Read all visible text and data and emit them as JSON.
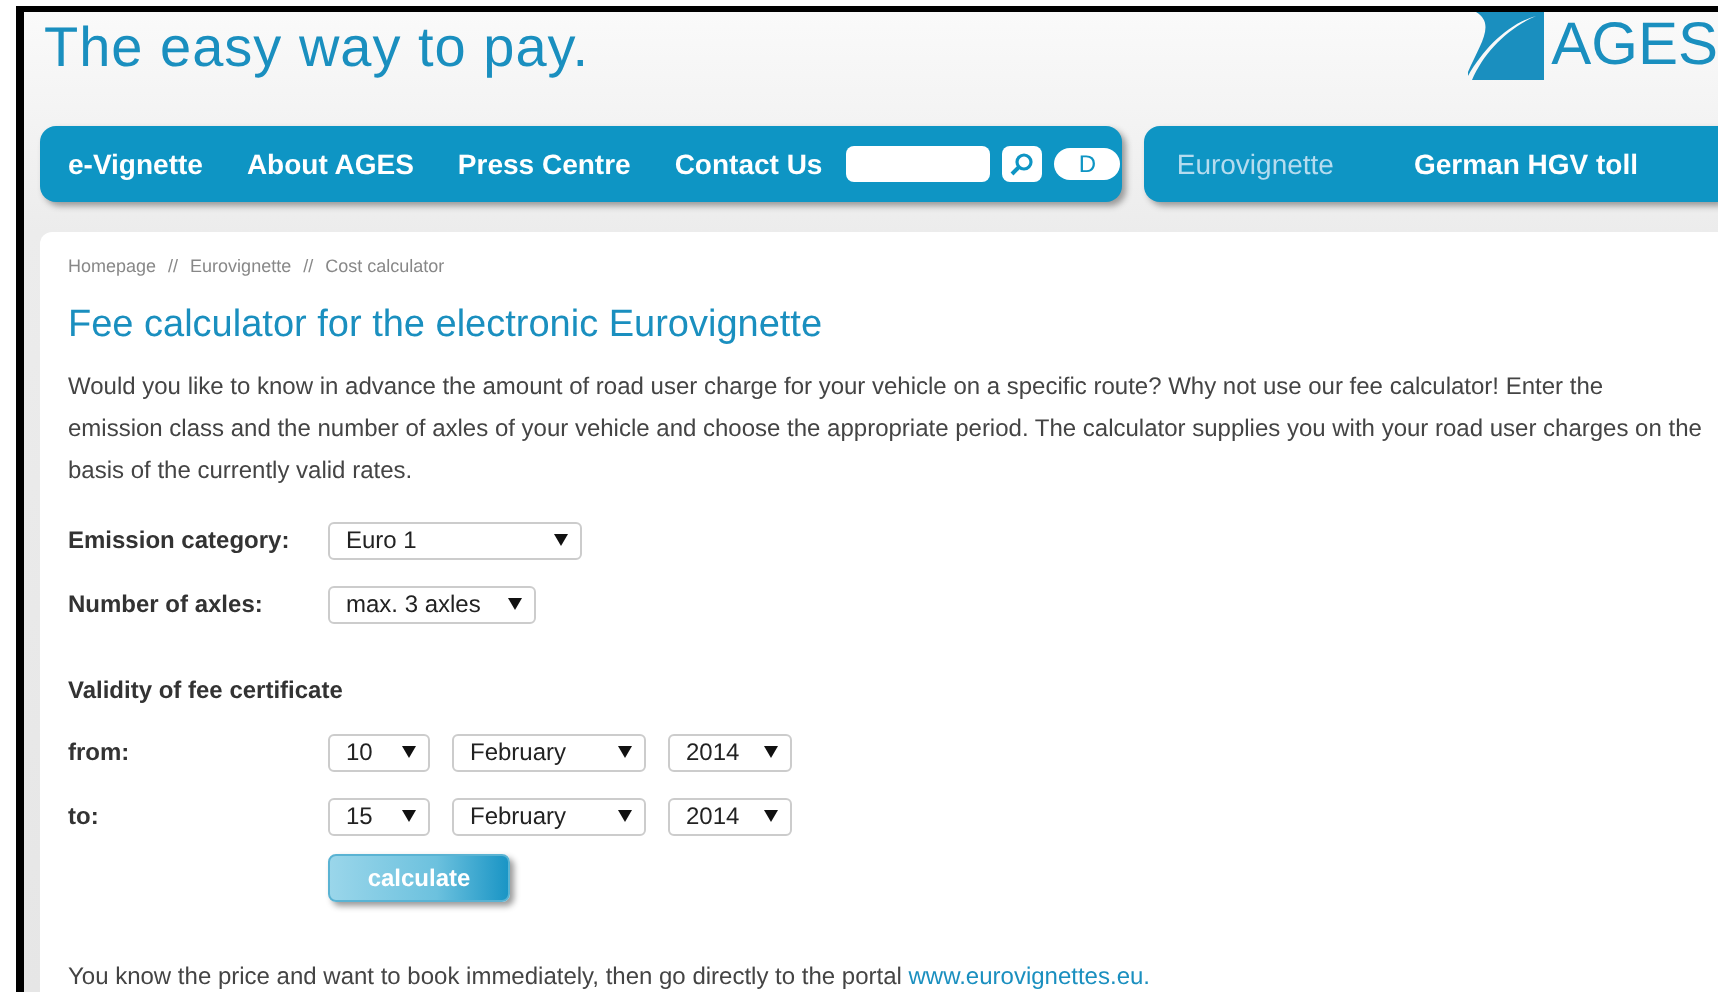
{
  "header": {
    "slogan": "The easy way to pay.",
    "logo_text": "AGES"
  },
  "nav_main": [
    {
      "label": "e-Vignette",
      "selected": false
    },
    {
      "label": "About AGES",
      "selected": false
    },
    {
      "label": "Press Centre",
      "selected": false
    },
    {
      "label": "Contact Us",
      "selected": false
    }
  ],
  "search": {
    "language_button": "D"
  },
  "nav_sections": [
    {
      "label": "Eurovignette",
      "selected": true
    },
    {
      "label": "German HGV toll",
      "selected": false
    }
  ],
  "breadcrumb": [
    "Homepage",
    "Eurovignette",
    "Cost calculator"
  ],
  "breadcrumb_separator": "//",
  "heading": "Fee calculator for the electronic Eurovignette",
  "intro": "Would you like to know in advance the amount of road user charge for your vehicle on a specific route? Why not use our fee calculator! Enter the emission class and the number of axles of your vehicle and choose the appropriate period. The calculator supplies you with your road user charges on the basis of the currently valid rates.",
  "fields": [
    {
      "label": "Emission category:",
      "value": "Euro 1"
    },
    {
      "label": "Number of axles:",
      "value": "max. 3 axles"
    }
  ],
  "validity": {
    "title": "Validity of fee certificate",
    "rows": [
      {
        "label": "from:",
        "day": "10",
        "month": "February",
        "year": "2014"
      },
      {
        "label": "to:",
        "day": "15",
        "month": "February",
        "year": "2014"
      }
    ]
  },
  "calculate_button": "calculate",
  "footer": {
    "text": "You know the price and want to book immediately, then go directly to the portal",
    "link": "www.eurovignettes.eu."
  }
}
